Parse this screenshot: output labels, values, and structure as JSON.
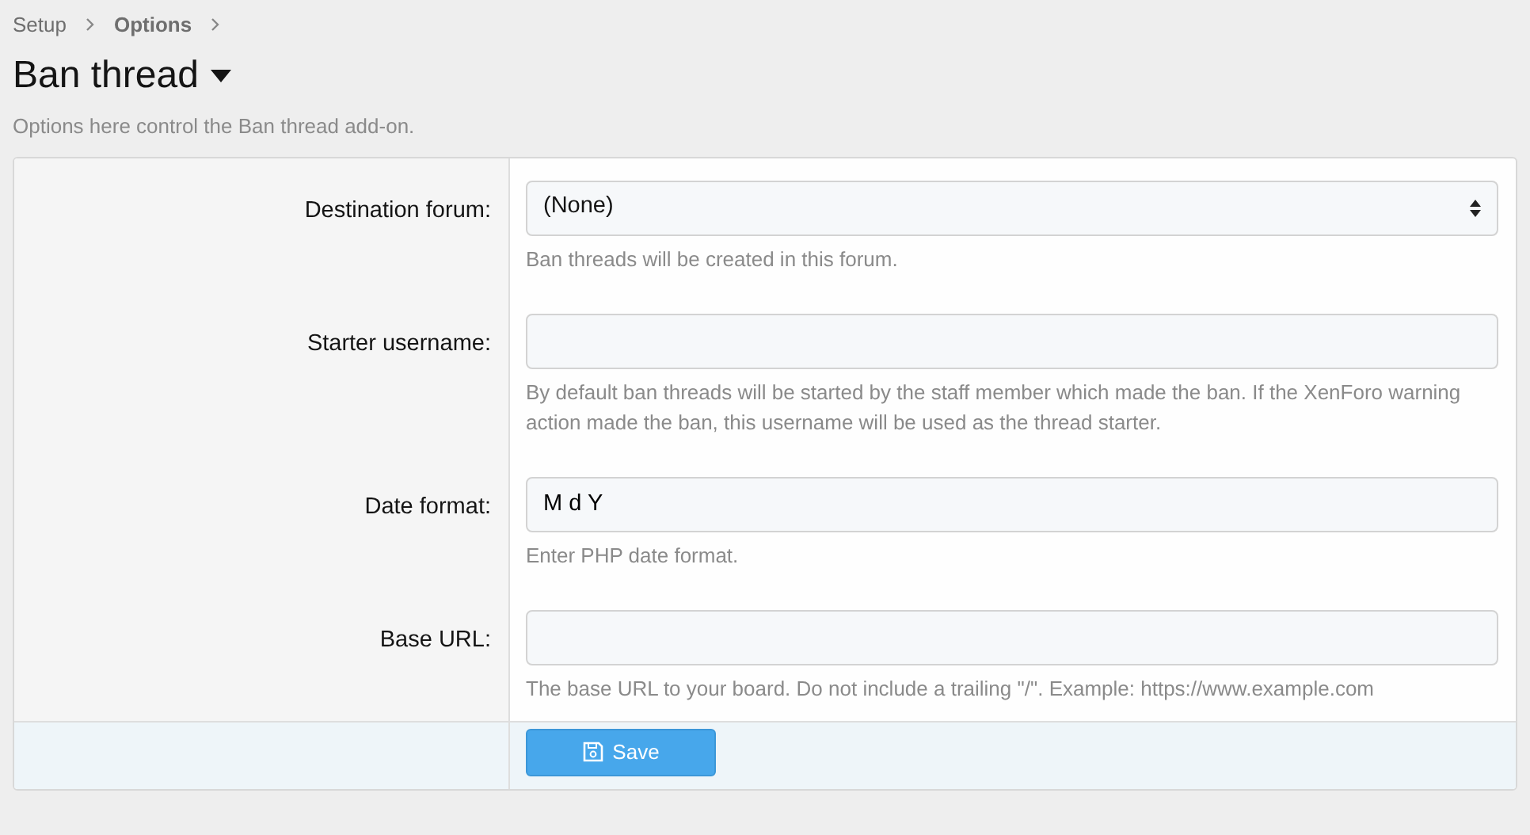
{
  "breadcrumb": [
    {
      "label": "Setup"
    },
    {
      "label": "Options"
    }
  ],
  "title": "Ban thread",
  "description": "Options here control the Ban thread add-on.",
  "options": [
    {
      "kind": "select",
      "label": "Destination forum:",
      "value": "(None)",
      "hint": "Ban threads will be created in this forum."
    },
    {
      "kind": "text",
      "label": "Starter username:",
      "hint": "By default ban threads will be started by the staff member which made the ban. If the XenForo warning action made the ban, this username will be used as the thread starter."
    },
    {
      "kind": "text",
      "label": "Date format:",
      "value": "M d Y",
      "hint": "Enter PHP date format."
    },
    {
      "kind": "text",
      "label": "Base URL:",
      "hint": "The base URL to your board. Do not include a trailing \"/\". Example: https://www.example.com"
    }
  ],
  "save_button": {
    "label": "Save"
  }
}
